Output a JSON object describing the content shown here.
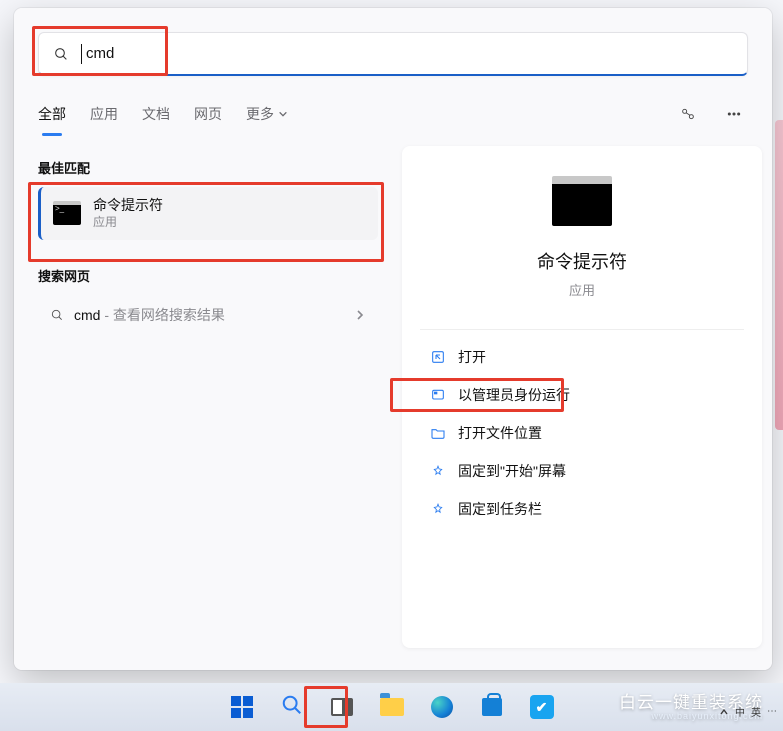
{
  "search": {
    "query": "cmd"
  },
  "tabs": {
    "items": [
      "全部",
      "应用",
      "文档",
      "网页"
    ],
    "more": "更多"
  },
  "left": {
    "best_match_header": "最佳匹配",
    "result_title": "命令提示符",
    "result_subtitle": "应用",
    "web_header": "搜索网页",
    "web_term": "cmd",
    "web_hint": " - 查看网络搜索结果"
  },
  "detail": {
    "title": "命令提示符",
    "subtitle": "应用",
    "actions": [
      "打开",
      "以管理员身份运行",
      "打开文件位置",
      "固定到\"开始\"屏幕",
      "固定到任务栏"
    ]
  },
  "brand": {
    "line1": "白云一键重装系统",
    "line2": "www.baiyunxitong.com"
  },
  "tray": {
    "ime1": "中",
    "ime2": "英"
  }
}
